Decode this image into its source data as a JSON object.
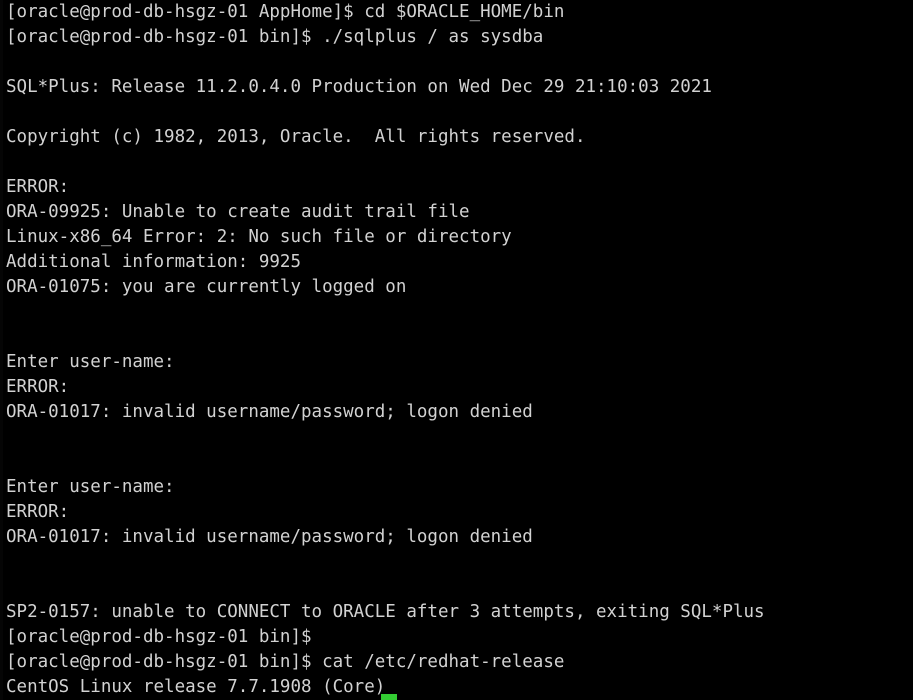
{
  "terminal": {
    "background_color": "#000000",
    "foreground_color": "#d2d2d2",
    "cursor_color": "#33cc33",
    "columns": 76,
    "rows": 28,
    "prompt_user": "oracle",
    "prompt_host": "prod-db-hsgz-01",
    "cursor": {
      "visible": true,
      "shape": "block",
      "column": 31,
      "row": 28
    },
    "lines": [
      {
        "id": "l01",
        "kind": "prompt",
        "text": "[oracle@prod-db-hsgz-01 AppHome]$ cd $ORACLE_HOME/bin"
      },
      {
        "id": "l02",
        "kind": "prompt",
        "text": "[oracle@prod-db-hsgz-01 bin]$ ./sqlplus / as sysdba"
      },
      {
        "id": "l03",
        "kind": "blank",
        "text": ""
      },
      {
        "id": "l04",
        "kind": "output",
        "text": "SQL*Plus: Release 11.2.0.4.0 Production on Wed Dec 29 21:10:03 2021"
      },
      {
        "id": "l05",
        "kind": "blank",
        "text": ""
      },
      {
        "id": "l06",
        "kind": "output",
        "text": "Copyright (c) 1982, 2013, Oracle.  All rights reserved."
      },
      {
        "id": "l07",
        "kind": "blank",
        "text": ""
      },
      {
        "id": "l08",
        "kind": "error",
        "text": "ERROR:"
      },
      {
        "id": "l09",
        "kind": "error",
        "text": "ORA-09925: Unable to create audit trail file"
      },
      {
        "id": "l10",
        "kind": "error",
        "text": "Linux-x86_64 Error: 2: No such file or directory"
      },
      {
        "id": "l11",
        "kind": "error",
        "text": "Additional information: 9925"
      },
      {
        "id": "l12",
        "kind": "error",
        "text": "ORA-01075: you are currently logged on"
      },
      {
        "id": "l13",
        "kind": "blank",
        "text": ""
      },
      {
        "id": "l14",
        "kind": "blank",
        "text": ""
      },
      {
        "id": "l15",
        "kind": "prompt",
        "text": "Enter user-name:"
      },
      {
        "id": "l16",
        "kind": "error",
        "text": "ERROR:"
      },
      {
        "id": "l17",
        "kind": "error",
        "text": "ORA-01017: invalid username/password; logon denied"
      },
      {
        "id": "l18",
        "kind": "blank",
        "text": ""
      },
      {
        "id": "l19",
        "kind": "blank",
        "text": ""
      },
      {
        "id": "l20",
        "kind": "prompt",
        "text": "Enter user-name:"
      },
      {
        "id": "l21",
        "kind": "error",
        "text": "ERROR:"
      },
      {
        "id": "l22",
        "kind": "error",
        "text": "ORA-01017: invalid username/password; logon denied"
      },
      {
        "id": "l23",
        "kind": "blank",
        "text": ""
      },
      {
        "id": "l24",
        "kind": "blank",
        "text": ""
      },
      {
        "id": "l25",
        "kind": "error",
        "text": "SP2-0157: unable to CONNECT to ORACLE after 3 attempts, exiting SQL*Plus"
      },
      {
        "id": "l26",
        "kind": "prompt",
        "text": "[oracle@prod-db-hsgz-01 bin]$"
      },
      {
        "id": "l27",
        "kind": "prompt",
        "text": "[oracle@prod-db-hsgz-01 bin]$ cat /etc/redhat-release"
      },
      {
        "id": "l28",
        "kind": "output",
        "text": "CentOS Linux release 7.7.1908 (Core)"
      }
    ]
  }
}
